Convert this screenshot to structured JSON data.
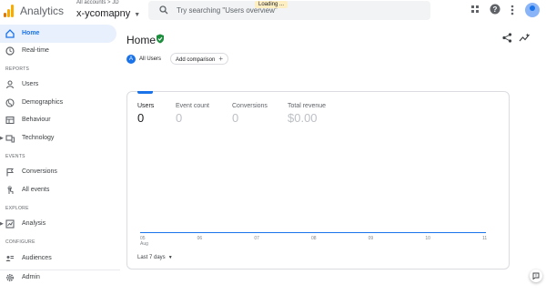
{
  "header": {
    "app_title": "Analytics",
    "account_path": "All accounts > JD",
    "property_name": "x-ycomapny",
    "search_placeholder": "Try searching \"Users overview\"",
    "loading_text": "Loading ..."
  },
  "sidebar": {
    "items": [
      {
        "label": "Home",
        "icon": "home-icon",
        "active": true
      },
      {
        "label": "Real-time",
        "icon": "clock-icon"
      },
      {
        "label": "Users",
        "icon": "person-icon"
      },
      {
        "label": "Demographics",
        "icon": "globe-icon"
      },
      {
        "label": "Behaviour",
        "icon": "page-icon"
      },
      {
        "label": "Technology",
        "icon": "devices-icon"
      },
      {
        "label": "Conversions",
        "icon": "flag-icon"
      },
      {
        "label": "All events",
        "icon": "touch-icon"
      },
      {
        "label": "Analysis",
        "icon": "analysis-icon"
      },
      {
        "label": "Audiences",
        "icon": "audiences-icon"
      },
      {
        "label": "Admin",
        "icon": "gear-icon"
      }
    ],
    "sections": [
      "REPORTS",
      "EVENTS",
      "EXPLORE",
      "CONFIGURE"
    ]
  },
  "main": {
    "title": "Home",
    "comparison_chip": {
      "badge": "A",
      "label": "All Users"
    },
    "add_comparison": "Add comparison",
    "metrics": [
      {
        "label": "Users",
        "value": "0"
      },
      {
        "label": "Event count",
        "value": "0"
      },
      {
        "label": "Conversions",
        "value": "0"
      },
      {
        "label": "Total revenue",
        "value": "$0.00"
      }
    ],
    "chart": {
      "x_ticks": [
        {
          "day": "05",
          "month": "Aug"
        },
        {
          "day": "06",
          "month": ""
        },
        {
          "day": "07",
          "month": ""
        },
        {
          "day": "08",
          "month": ""
        },
        {
          "day": "09",
          "month": ""
        },
        {
          "day": "10",
          "month": ""
        },
        {
          "day": "11",
          "month": ""
        }
      ]
    },
    "date_range": "Last 7 days"
  },
  "colors": {
    "accent": "#1a73e8",
    "active_bg": "#e8f0fe",
    "logo_orange": "#f9ab00",
    "logo_dark_orange": "#e37400",
    "verified_green": "#1e8e3e"
  }
}
